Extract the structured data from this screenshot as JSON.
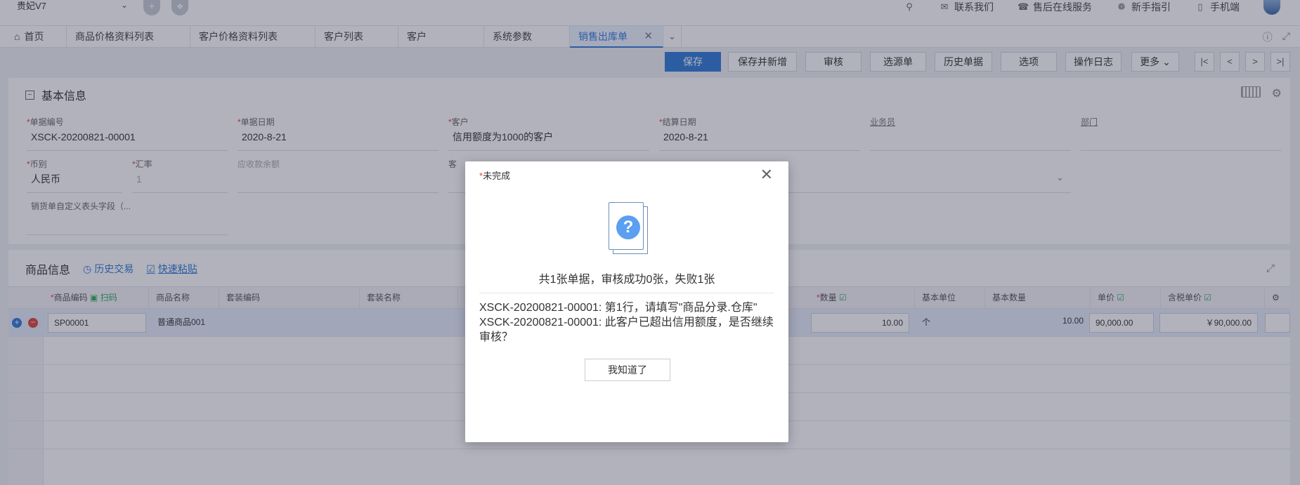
{
  "app": {
    "brand": "贵妃V7"
  },
  "topbar": {
    "links": [
      {
        "label": "联系我们",
        "icon": "chat-icon"
      },
      {
        "label": "售后在线服务",
        "icon": "headset-icon"
      },
      {
        "label": "新手指引",
        "icon": "compass-icon"
      },
      {
        "label": "手机端",
        "icon": "phone-icon"
      }
    ]
  },
  "tabs": [
    {
      "label": "首页"
    },
    {
      "label": "商品价格资料列表"
    },
    {
      "label": "客户价格资料列表"
    },
    {
      "label": "客户列表"
    },
    {
      "label": "客户"
    },
    {
      "label": "系统参数"
    },
    {
      "label": "销售出库单",
      "active": true
    }
  ],
  "toolbar": {
    "save": "保存",
    "save_new": "保存并新增",
    "audit": "审核",
    "source": "选源单",
    "history": "历史单据",
    "options": "选项",
    "log": "操作日志",
    "more": "更多"
  },
  "basic": {
    "title": "基本信息",
    "fields": {
      "doc_no": {
        "label": "单据编号",
        "value": "XSCK-20200821-00001"
      },
      "doc_date": {
        "label": "单据日期",
        "value": "2020-8-21"
      },
      "customer": {
        "label": "客户",
        "value": "信用额度为1000的客户"
      },
      "settle_date": {
        "label": "结算日期",
        "value": "2020-8-21"
      },
      "salesman": {
        "label": "业务员",
        "value": ""
      },
      "dept": {
        "label": "部门",
        "value": ""
      },
      "currency": {
        "label": "币别",
        "value": "人民币"
      },
      "rate": {
        "label": "汇率",
        "value": "1"
      },
      "receivable": {
        "label": "应收款余额",
        "value": ""
      },
      "customer2": {
        "label": "客",
        "value": ""
      },
      "custom_header": {
        "label": "销货单自定义表头字段（...",
        "value": ""
      }
    }
  },
  "goods": {
    "title": "商品信息",
    "history_link": "历史交易",
    "paste_link": "快速粘贴",
    "columns": {
      "code": "商品编码",
      "scan": "扫码",
      "name": "商品名称",
      "set_code": "套装编码",
      "set_name": "套装名称",
      "qty": "数量",
      "base_unit": "基本单位",
      "base_qty": "基本数量",
      "price": "单价",
      "tax_price": "含税单价"
    },
    "rows": [
      {
        "code": "SP00001",
        "name": "普通商品001",
        "qty": "10.00",
        "unit": "个",
        "base_qty": "10.00",
        "price": "90,000.00",
        "tax_price": "￥90,000.00"
      }
    ]
  },
  "modal": {
    "title": "未完成",
    "summary": "共1张单据，审核成功0张，失败1张",
    "messages": [
      "XSCK-20200821-00001: 第1行，请填写\"商品分录.仓库\"",
      "XSCK-20200821-00001: 此客户已超出信用额度，是否继续审核？"
    ],
    "ok": "我知道了"
  }
}
